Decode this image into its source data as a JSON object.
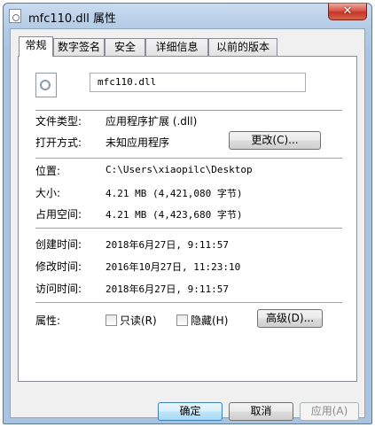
{
  "window": {
    "title": "mfc110.dll 属性",
    "close_glyph": "✕"
  },
  "tabs": [
    {
      "label": "常规",
      "active": true
    },
    {
      "label": "数字签名",
      "active": false
    },
    {
      "label": "安全",
      "active": false
    },
    {
      "label": "详细信息",
      "active": false
    },
    {
      "label": "以前的版本",
      "active": false
    }
  ],
  "general": {
    "file_icon": "dll-file-icon",
    "file_name": "mfc110.dll",
    "type_label": "文件类型:",
    "type_value": "应用程序扩展 (.dll)",
    "opens_label": "打开方式:",
    "opens_value": "未知应用程序",
    "change_button": "更改(C)...",
    "location_label": "位置:",
    "location_value": "C:\\Users\\xiaopilc\\Desktop",
    "size_label": "大小:",
    "size_value": "4.21 MB (4,421,080 字节)",
    "disk_label": "占用空间:",
    "disk_value": "4.21 MB (4,423,680 字节)",
    "created_label": "创建时间:",
    "created_value": "2018年6月27日, 9:11:57",
    "modified_label": "修改时间:",
    "modified_value": "2016年10月27日, 11:23:10",
    "accessed_label": "访问时间:",
    "accessed_value": "2018年6月27日, 9:11:57",
    "attributes_label": "属性:",
    "readonly_label": "只读(R)",
    "readonly_checked": false,
    "hidden_label": "隐藏(H)",
    "hidden_checked": false,
    "advanced_button": "高级(D)..."
  },
  "footer": {
    "ok": "确定",
    "cancel": "取消",
    "apply": "应用(A)"
  }
}
